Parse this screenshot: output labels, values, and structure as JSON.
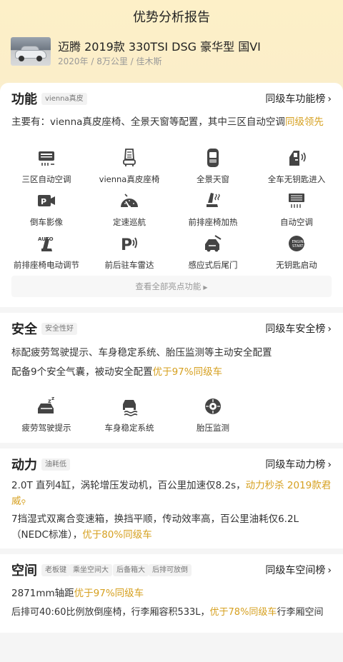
{
  "page_title": "优势分析报告",
  "car": {
    "name": "迈腾 2019款 330TSI DSG 豪华型 国VI",
    "meta": "2020年 / 8万公里 / 佳木斯"
  },
  "colors": {
    "accent": "#d6a020",
    "top_gradient": "#fdf0c8",
    "icon": "#444444"
  },
  "function": {
    "title": "功能",
    "tag": "vienna真皮",
    "rank_link": "同级车功能榜",
    "summary_pre": "主要有：vienna真皮座椅、全景天窗等配置，其中三区自动空调",
    "summary_hl": "级领先",
    "summary_hl_pre": "同",
    "features": [
      {
        "label": "三区自动空调",
        "icon": "climate-control-icon"
      },
      {
        "label": "vienna真皮座椅",
        "icon": "leather-seat-icon"
      },
      {
        "label": "全景天窗",
        "icon": "sunroof-icon"
      },
      {
        "label": "全车无钥匙进入",
        "icon": "keyless-entry-icon"
      },
      {
        "label": "倒车影像",
        "icon": "reverse-camera-icon"
      },
      {
        "label": "定速巡航",
        "icon": "cruise-control-icon"
      },
      {
        "label": "前排座椅加热",
        "icon": "seat-heating-icon"
      },
      {
        "label": "自动空调",
        "icon": "auto-ac-icon"
      },
      {
        "label": "前排座椅电动调节",
        "icon": "power-seat-icon"
      },
      {
        "label": "前后驻车雷达",
        "icon": "parking-radar-icon"
      },
      {
        "label": "感应式后尾门",
        "icon": "tailgate-icon"
      },
      {
        "label": "无钥匙启动",
        "icon": "start-button-icon"
      }
    ],
    "more_label": "查看全部亮点功能"
  },
  "safety": {
    "title": "安全",
    "tag": "安全性好",
    "rank_link": "同级车安全榜",
    "line1": "标配疲劳驾驶提示、车身稳定系统、胎压监测等主动安全配置",
    "line2_pre": "配备9个安全气囊，被动安全配置",
    "line2_hl": "优于97%同级车",
    "features": [
      {
        "label": "疲劳驾驶提示",
        "icon": "fatigue-alert-icon"
      },
      {
        "label": "车身稳定系统",
        "icon": "stability-control-icon"
      },
      {
        "label": "胎压监测",
        "icon": "tire-pressure-icon"
      }
    ]
  },
  "power": {
    "title": "动力",
    "tag": "油耗低",
    "rank_link": "同级车动力榜",
    "line1_pre": "2.0T 直列4缸，涡轮增压发动机，百公里加速仅8.2s，",
    "line1_hl1": "动力秒杀 2019款君",
    "line1_hl2": "威",
    "line2_pre": "7挡湿式双离合变速箱，换挡平顺，传动效率高，百公里油耗仅6.2L（NEDC标准），",
    "line2_hl": "优于80%同级车"
  },
  "space": {
    "title": "空间",
    "tags": [
      "老板键",
      "乘坐空间大",
      "后备箱大",
      "后排可放倒"
    ],
    "rank_link": "同级车空间榜",
    "line1_pre": "2871mm轴距",
    "line1_hl": "优于97%同级车",
    "line2_pre": "后排可40:60比例放倒座椅，行李厢容积533L，",
    "line2_hl": "优于78%同级车",
    "line2_post": "行李厢空间"
  }
}
